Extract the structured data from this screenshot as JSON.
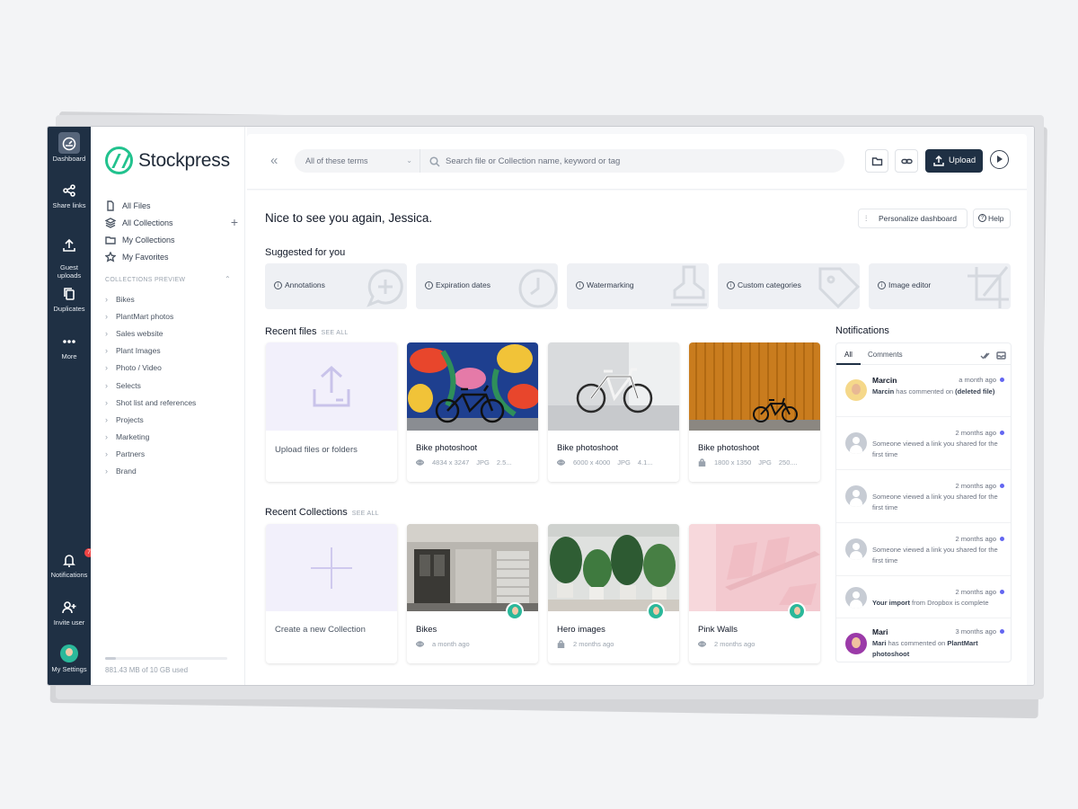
{
  "rail": {
    "items": [
      {
        "label": "Dashboard",
        "icon": "dashboard-gauge-icon"
      },
      {
        "label": "Share links",
        "icon": "share-icon"
      },
      {
        "label": "Guest\nuploads",
        "icon": "upload-icon"
      },
      {
        "label": "Duplicates",
        "icon": "duplicate-icon"
      },
      {
        "label": "More",
        "icon": "more-dots-icon"
      }
    ],
    "bottom": [
      {
        "label": "Notifications",
        "icon": "bell-icon",
        "badge": "7"
      },
      {
        "label": "Invite user",
        "icon": "add-user-icon"
      },
      {
        "label": "My Settings",
        "icon": "avatar"
      }
    ]
  },
  "sidebar": {
    "brand": "Stockpress",
    "nav": [
      {
        "label": "All Files",
        "icon": "file-icon"
      },
      {
        "label": "All Collections",
        "icon": "layers-icon"
      },
      {
        "label": "My Collections",
        "icon": "folder-icon"
      },
      {
        "label": "My Favorites",
        "icon": "star-icon"
      }
    ],
    "add_collection": "+",
    "collections_heading": "COLLECTIONS PREVIEW",
    "collections": [
      "Bikes",
      "PlantMart photos",
      "Sales website",
      "Plant Images",
      "Photo / Video",
      "Selects",
      "Shot list and references",
      "Projects",
      "Marketing",
      "Partners",
      "Brand"
    ],
    "storage_text": "881.43 MB of 10 GB used",
    "storage_used_fraction": 0.086
  },
  "topbar": {
    "filter_value": "All of these terms",
    "search_placeholder": "Search file or Collection name, keyword or tag",
    "upload_label": "Upload"
  },
  "content": {
    "greeting": "Nice to see you again, Jessica.",
    "personalize_label": "Personalize dashboard",
    "help_label": "Help",
    "suggested_title": "Suggested for you",
    "suggestions": [
      "Annotations",
      "Expiration dates",
      "Watermarking",
      "Custom categories",
      "Image editor"
    ],
    "recent_files_title": "Recent files",
    "see_all": "SEE ALL",
    "upload_card_label": "Upload files or folders",
    "files": [
      {
        "title": "Bike photoshoot",
        "dims": "4834 x 3247",
        "type": "JPG",
        "size": "2.5...",
        "visibility": "eye-icon"
      },
      {
        "title": "Bike photoshoot",
        "dims": "6000 x 4000",
        "type": "JPG",
        "size": "4.1...",
        "visibility": "eye-icon"
      },
      {
        "title": "Bike photoshoot",
        "dims": "1800 x 1350",
        "type": "JPG",
        "size": "250....",
        "visibility": "lock-icon"
      }
    ],
    "recent_collections_title": "Recent Collections",
    "new_collection_label": "Create a new Collection",
    "collections": [
      {
        "title": "Bikes",
        "time": "a month ago",
        "visibility": "eye-icon"
      },
      {
        "title": "Hero images",
        "time": "2 months ago",
        "visibility": "lock-icon"
      },
      {
        "title": "Pink Walls",
        "time": "2 months ago",
        "visibility": "eye-icon"
      }
    ]
  },
  "notifications": {
    "title": "Notifications",
    "tabs": [
      "All",
      "Comments"
    ],
    "items": [
      {
        "name": "Marcin",
        "time": "a month ago",
        "actor": "Marcin",
        "text": " has commented on ",
        "object": "(deleted file)"
      },
      {
        "name": "",
        "time": "2 months ago",
        "text": "Someone viewed a link you shared for the first time"
      },
      {
        "name": "",
        "time": "2 months ago",
        "text": "Someone viewed a link you shared for the first time"
      },
      {
        "name": "",
        "time": "2 months ago",
        "text": "Someone viewed a link you shared for the first time"
      },
      {
        "name": "",
        "time": "2 months ago",
        "actor": "Your import",
        "text": " from Dropbox is complete"
      },
      {
        "name": "Mari",
        "time": "3 months ago",
        "actor": "Mari",
        "text": " has commented on ",
        "object": "PlantMart photoshoot"
      }
    ]
  },
  "colors": {
    "rail_bg": "#1f3044",
    "brand_green": "#22c28e",
    "upload_btn": "#1f3044",
    "accent_dot": "#6366f1"
  }
}
